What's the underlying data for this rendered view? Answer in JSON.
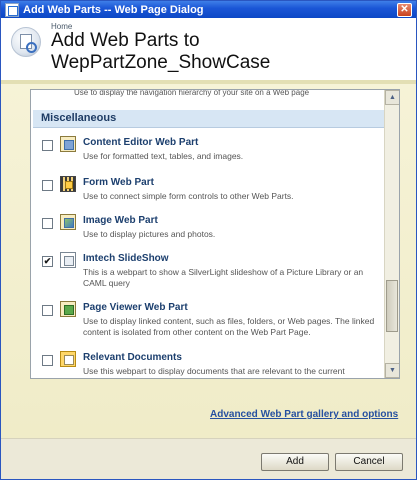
{
  "window": {
    "title": "Add Web Parts -- Web Page Dialog",
    "close_symbol": "✕"
  },
  "header": {
    "breadcrumb": "Home",
    "title": "Add Web Parts to WepPartZone_ShowCase"
  },
  "list": {
    "partial_text": "Use to display the navigation hierarchy of your site on a Web page",
    "category": "Miscellaneous",
    "items": [
      {
        "title": "Content Editor Web Part",
        "description": "Use for formatted text, tables, and images.",
        "checked": false,
        "check_mark": "",
        "icon": "content-editor-icon"
      },
      {
        "title": "Form Web Part",
        "description": "Use to connect simple form controls to other Web Parts.",
        "checked": false,
        "check_mark": "",
        "icon": "form-icon"
      },
      {
        "title": "Image Web Part",
        "description": "Use to display pictures and photos.",
        "checked": false,
        "check_mark": "",
        "icon": "image-icon"
      },
      {
        "title": "Imtech SlideShow",
        "description": "This is a webpart to show a SilverLight slideshow of a Picture Library or an CAML query",
        "checked": true,
        "check_mark": "✔",
        "icon": "slideshow-icon"
      },
      {
        "title": "Page Viewer Web Part",
        "description": "Use to display linked content, such as files, folders, or Web pages. The linked content is isolated from other content on the Web Part Page.",
        "checked": false,
        "check_mark": "",
        "icon": "page-viewer-icon"
      },
      {
        "title": "Relevant Documents",
        "description": "Use this webpart to display documents that are relevant to the current",
        "checked": false,
        "check_mark": "",
        "icon": "documents-icon"
      }
    ]
  },
  "links": {
    "gallery": "Advanced Web Part gallery and options"
  },
  "buttons": {
    "add": "Add",
    "cancel": "Cancel"
  },
  "scrollbar": {
    "up_symbol": "▲",
    "down_symbol": "▼"
  },
  "colors": {
    "titlebar": "#0a46c4",
    "category_bg": "#d7e6f4",
    "link": "#2650a0",
    "content_bg": "#f6f3d7"
  }
}
